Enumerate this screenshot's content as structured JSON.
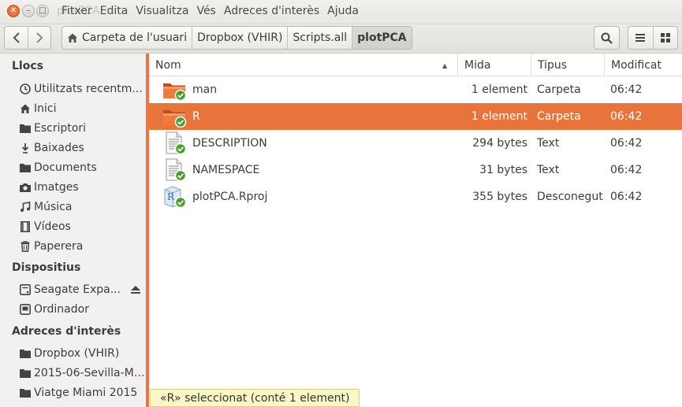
{
  "window": {
    "ghost_title": "plotPCA",
    "menu": [
      "Fitxer",
      "Edita",
      "Visualitza",
      "Vés",
      "Adreces d'interès",
      "Ajuda"
    ]
  },
  "breadcrumbs": [
    "Carpeta de l'usuari",
    "Dropbox (VHIR)",
    "Scripts.all",
    "plotPCA"
  ],
  "sidebar": {
    "sections": [
      {
        "title": "Llocs",
        "items": [
          {
            "label": "Utilitzats recentm...",
            "icon": "clock-icon"
          },
          {
            "label": "Inici",
            "icon": "home-icon"
          },
          {
            "label": "Escriptori",
            "icon": "folder-icon"
          },
          {
            "label": "Baixades",
            "icon": "download-icon"
          },
          {
            "label": "Documents",
            "icon": "folder-icon"
          },
          {
            "label": "Imatges",
            "icon": "camera-icon"
          },
          {
            "label": "Música",
            "icon": "music-icon"
          },
          {
            "label": "Vídeos",
            "icon": "film-icon"
          },
          {
            "label": "Paperera",
            "icon": "trash-icon"
          }
        ]
      },
      {
        "title": "Dispositius",
        "items": [
          {
            "label": "Seagate Expa...",
            "icon": "drive-icon"
          },
          {
            "label": "Ordinador",
            "icon": "computer-icon"
          }
        ]
      },
      {
        "title": "Adreces d'interès",
        "items": [
          {
            "label": "Dropbox (VHIR)",
            "icon": "folder-icon"
          },
          {
            "label": "2015-06-Sevilla-Me...",
            "icon": "folder-icon"
          },
          {
            "label": "Viatge Miami 2015",
            "icon": "folder-icon"
          }
        ]
      }
    ]
  },
  "columns": {
    "name": "Nom",
    "size": "Mida",
    "type": "Tipus",
    "modified": "Modificat"
  },
  "files": [
    {
      "name": "man",
      "size": "1 element",
      "type": "Carpeta",
      "modified": "06:42",
      "icon": "folder-icon",
      "selected": false
    },
    {
      "name": "R",
      "size": "1 element",
      "type": "Carpeta",
      "modified": "06:42",
      "icon": "folder-icon",
      "selected": true
    },
    {
      "name": "DESCRIPTION",
      "size": "294 bytes",
      "type": "Text",
      "modified": "06:42",
      "icon": "text-file-icon",
      "selected": false
    },
    {
      "name": "NAMESPACE",
      "size": "31 bytes",
      "type": "Text",
      "modified": "06:42",
      "icon": "text-file-icon",
      "selected": false
    },
    {
      "name": "plotPCA.Rproj",
      "size": "355 bytes",
      "type": "Desconegut",
      "modified": "06:42",
      "icon": "rproj-file-icon",
      "selected": false
    }
  ],
  "status": "«R» seleccionat  (conté 1 element)",
  "colors": {
    "accent": "#e7743c",
    "status_bg": "#fcf7c6",
    "sync_badge": "#4d9a2f"
  }
}
